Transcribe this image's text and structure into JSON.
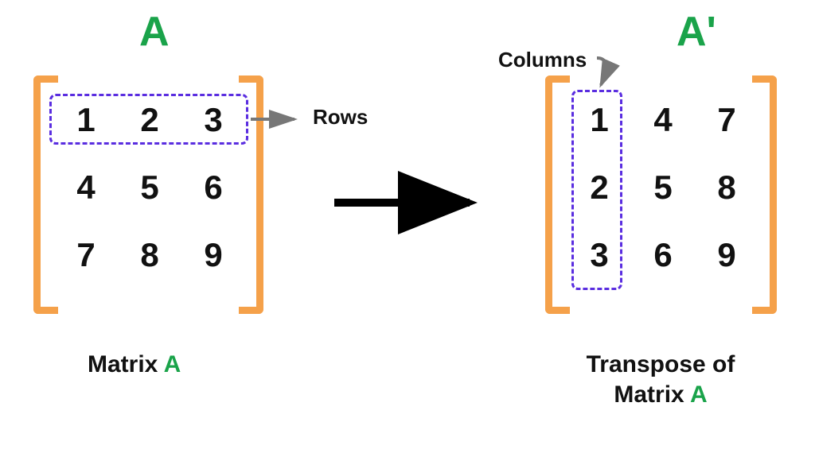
{
  "titles": {
    "A": "A",
    "Aprime": "A'"
  },
  "matrixA": {
    "r1c1": "1",
    "r1c2": "2",
    "r1c3": "3",
    "r2c1": "4",
    "r2c2": "5",
    "r2c3": "6",
    "r3c1": "7",
    "r3c2": "8",
    "r3c3": "9"
  },
  "matrixAT": {
    "r1c1": "1",
    "r1c2": "4",
    "r1c3": "7",
    "r2c1": "2",
    "r2c2": "5",
    "r2c3": "8",
    "r3c1": "3",
    "r3c2": "6",
    "r3c3": "9"
  },
  "labels": {
    "rows": "Rows",
    "columns": "Columns"
  },
  "captions": {
    "left_prefix": "Matrix  ",
    "left_A": "A",
    "right_line1": "Transpose of",
    "right_line2_prefix": "Matrix  ",
    "right_A": "A"
  },
  "chart_data": {
    "type": "table",
    "description": "Matrix transpose diagram: rows of A become columns of A'",
    "matrix_A": [
      [
        1,
        2,
        3
      ],
      [
        4,
        5,
        6
      ],
      [
        7,
        8,
        9
      ]
    ],
    "matrix_A_transpose": [
      [
        1,
        4,
        7
      ],
      [
        2,
        5,
        8
      ],
      [
        3,
        6,
        9
      ]
    ],
    "highlight": {
      "A": "first row",
      "A_transpose": "first column"
    }
  }
}
